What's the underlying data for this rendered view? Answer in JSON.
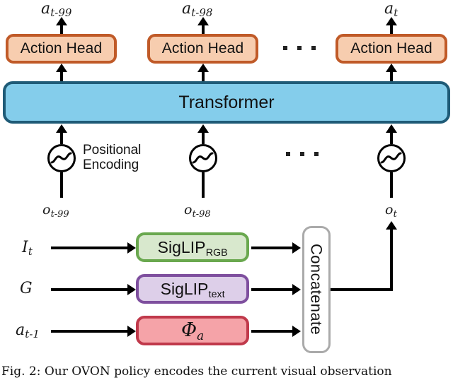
{
  "figure": {
    "caption": "Fig. 2: Our OVON policy encodes the current visual observation",
    "ellipsis": "· · ·"
  },
  "outputs": {
    "labels": [
      {
        "base": "a",
        "sub": "t-99"
      },
      {
        "base": "a",
        "sub": "t-98"
      },
      {
        "base": "a",
        "sub": "t"
      }
    ]
  },
  "action_heads": {
    "label": "Action Head",
    "fill_color": "#f7cdaf",
    "border_color": "#c05a28",
    "items": [
      {
        "label": "Action Head"
      },
      {
        "label": "Action Head"
      },
      {
        "label": "Action Head"
      }
    ]
  },
  "transformer": {
    "label": "Transformer",
    "fill_color": "#84cdeb",
    "border_color": "#1f5b77"
  },
  "positional_encoding": {
    "label_line1": "Positional",
    "label_line2": "Encoding",
    "icon": "sine-wave-icon",
    "count": 3
  },
  "observations": {
    "labels": [
      {
        "base": "o",
        "sub": "t-99"
      },
      {
        "base": "o",
        "sub": "t-98"
      },
      {
        "base": "o",
        "sub": "t"
      }
    ]
  },
  "encoder": {
    "inputs": [
      {
        "base": "I",
        "sub": "t"
      },
      {
        "base": "G",
        "sub": ""
      },
      {
        "base": "a",
        "sub": "t-1"
      }
    ],
    "modules": [
      {
        "name": "SigLIP",
        "subscript": "RGB",
        "fill_color": "#d8e8cd",
        "border_color": "#6aa84f"
      },
      {
        "name": "SigLIP",
        "subscript": "text",
        "fill_color": "#ddcfe9",
        "border_color": "#7e4f9e"
      },
      {
        "name": "Φ",
        "subscript": "a",
        "fill_color": "#f5a3a8",
        "border_color": "#c0394b"
      }
    ],
    "concatenate": {
      "label": "Concatenate",
      "fill_color": "#ffffff",
      "border_color": "#aaaaaa"
    }
  }
}
